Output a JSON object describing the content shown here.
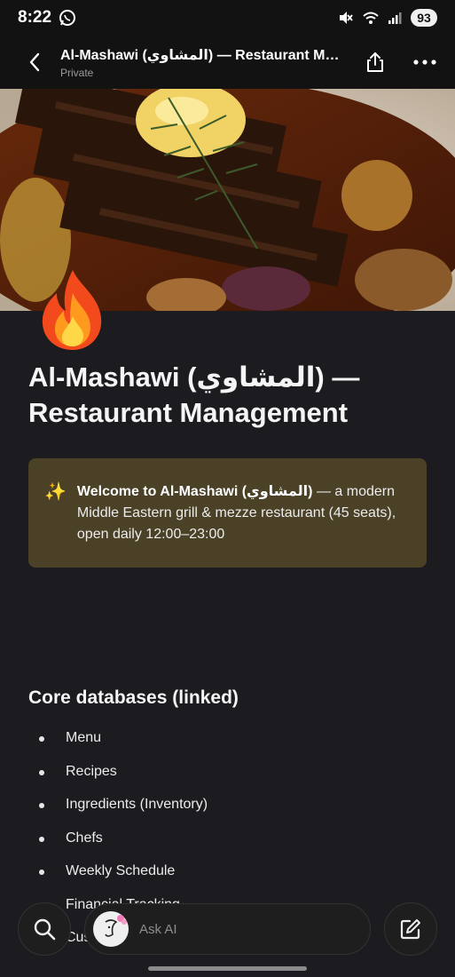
{
  "status": {
    "time": "8:22",
    "battery": "93"
  },
  "topbar": {
    "page_name": "Al-Mashawi (المشاوي) — Restaurant Ma...",
    "visibility": "Private"
  },
  "page": {
    "title": "Al-Mashawi (المشاوي) — Restaurant Management",
    "icon": "fire-emoji"
  },
  "callout": {
    "icon": "✨",
    "bold": "Welcome to Al-Mashawi (المشاوي)",
    "text": " — a modern Middle Eastern grill & mezze restaurant (45 seats), open daily 12:00–23:00"
  },
  "section": {
    "heading": "Core databases (linked)",
    "items": [
      "Menu",
      "Recipes",
      "Ingredients (Inventory)",
      "Chefs",
      "Weekly Schedule",
      "Financial Tracking",
      "Customers"
    ]
  },
  "bottom": {
    "ask_placeholder": "Ask AI"
  },
  "colors": {
    "background": "#1c1b1f",
    "callout_bg": "#4a4127",
    "topbar_bg": "#121212"
  }
}
